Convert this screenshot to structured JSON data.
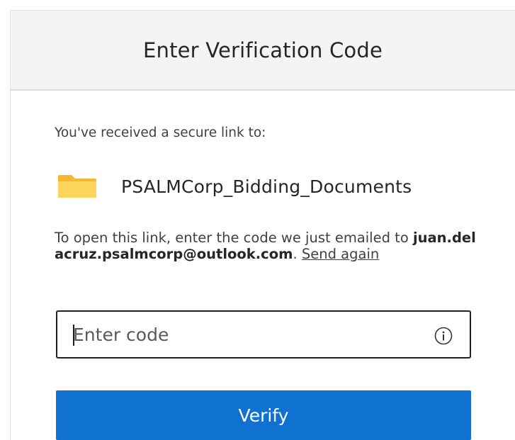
{
  "header": {
    "title": "Enter Verification Code"
  },
  "intro": {
    "text": "You've received a secure link to:"
  },
  "file": {
    "icon": "folder-icon",
    "name": "PSALMCorp_Bidding_Documents",
    "icon_color": "#f6c64a"
  },
  "instructions": {
    "prefix": "To open this link, enter the code we just emailed to ",
    "email": "juan.delacruz.psalmcorp@outlook.com",
    "period": ". ",
    "send_again": "Send again"
  },
  "code_field": {
    "placeholder": "Enter code",
    "value": "",
    "info_icon": "info-icon"
  },
  "verify": {
    "label": "Verify",
    "color": "#1072d0"
  }
}
